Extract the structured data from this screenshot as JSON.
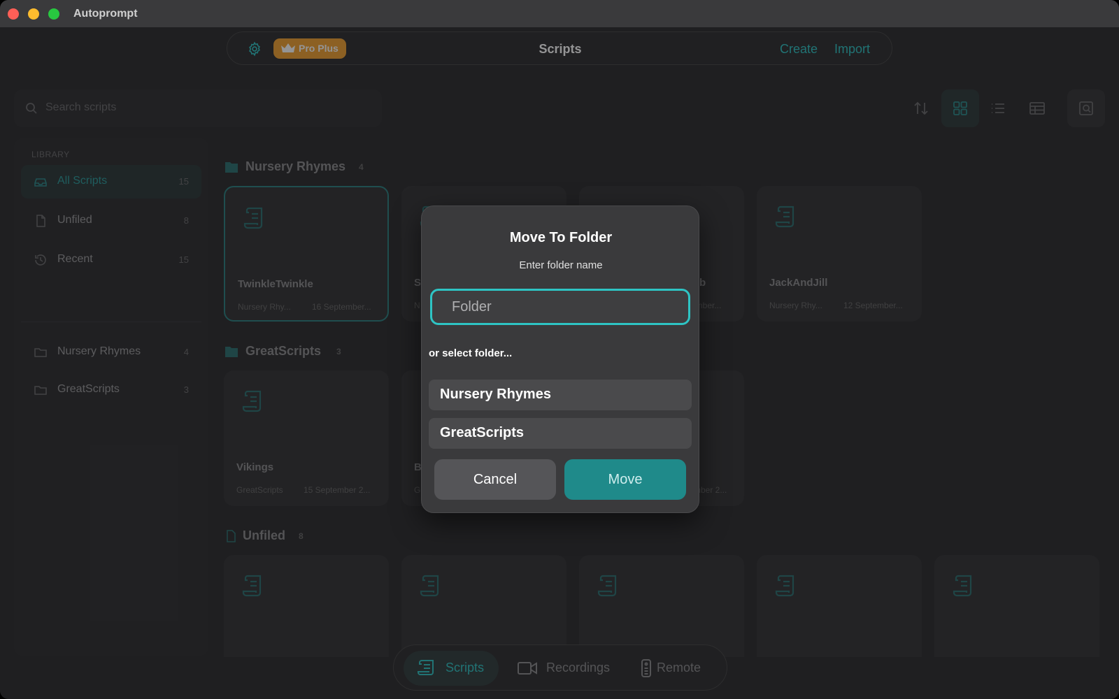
{
  "window": {
    "app_title": "Autoprompt"
  },
  "topbar": {
    "badge_label": "Pro Plus",
    "title": "Scripts",
    "create_label": "Create",
    "import_label": "Import"
  },
  "search": {
    "placeholder": "Search scripts"
  },
  "sidebar": {
    "header": "LIBRARY",
    "items": [
      {
        "label": "All Scripts",
        "count": "15",
        "icon": "library-icon"
      },
      {
        "label": "Unfiled",
        "count": "8",
        "icon": "document-icon"
      },
      {
        "label": "Recent",
        "count": "15",
        "icon": "history-icon"
      }
    ],
    "folders": [
      {
        "label": "Nursery Rhymes",
        "count": "4",
        "icon": "folder-icon"
      },
      {
        "label": "GreatScripts",
        "count": "3",
        "icon": "folder-icon"
      }
    ]
  },
  "sections": [
    {
      "title": "Nursery Rhymes",
      "count": "4",
      "cards": [
        {
          "title": "TwinkleTwinkle",
          "folder": "Nursery Rhy...",
          "date": "16 September..."
        },
        {
          "title": "S",
          "folder": "N",
          "date": ""
        },
        {
          "title": "b",
          "folder": "",
          "date": "ember..."
        },
        {
          "title": "JackAndJill",
          "folder": "Nursery Rhy...",
          "date": "12 September..."
        }
      ]
    },
    {
      "title": "GreatScripts",
      "count": "3",
      "cards": [
        {
          "title": "Vikings",
          "folder": "GreatScripts",
          "date": "15 September 2..."
        },
        {
          "title": "B",
          "folder": "G",
          "date": ""
        },
        {
          "title": "",
          "folder": "",
          "date": "mber 2..."
        }
      ]
    },
    {
      "title": "Unfiled",
      "count": "8"
    }
  ],
  "bottombar": {
    "scripts_label": "Scripts",
    "recordings_label": "Recordings",
    "remote_label": "Remote"
  },
  "dialog": {
    "title": "Move To Folder",
    "subtitle": "Enter folder name",
    "input_placeholder": "Folder",
    "or_select_label": "or select folder...",
    "folders": [
      "Nursery Rhymes",
      "GreatScripts"
    ],
    "cancel_label": "Cancel",
    "move_label": "Move"
  },
  "colors": {
    "accent": "#2ec4c4",
    "badge": "#f0a030",
    "background": "#2a2a2c",
    "dialog": "#3a3a3c"
  }
}
